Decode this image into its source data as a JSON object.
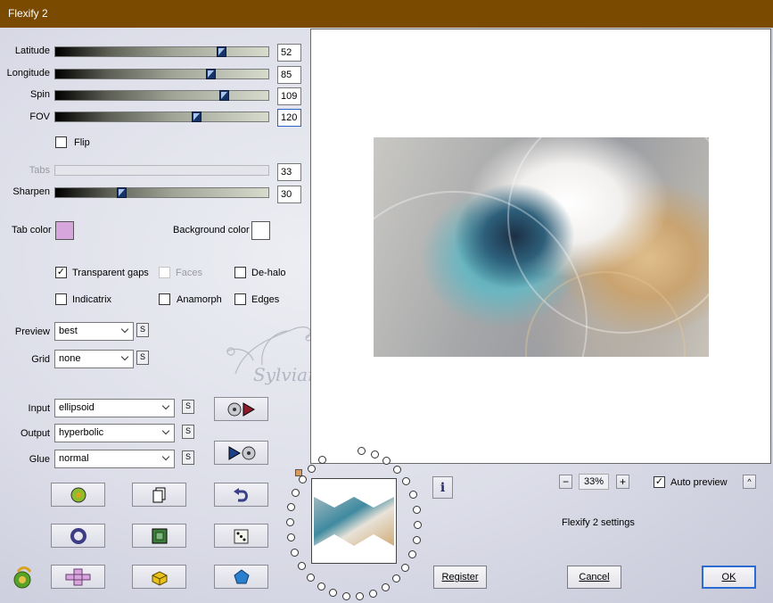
{
  "window": {
    "title": "Flexify 2"
  },
  "sliders": [
    {
      "label": "Latitude",
      "value": "52",
      "level": 0.78
    },
    {
      "label": "Longitude",
      "value": "85",
      "level": 0.73
    },
    {
      "label": "Spin",
      "value": "109",
      "level": 0.79
    },
    {
      "label": "FOV",
      "value": "120",
      "level": 0.66
    }
  ],
  "flip": {
    "label": "Flip",
    "checked": false
  },
  "tabs": {
    "label": "Tabs",
    "value": "33",
    "enabled": false
  },
  "sharpen": {
    "label": "Sharpen",
    "value": "30",
    "level": 0.31
  },
  "colors": {
    "tab_label": "Tab color",
    "tab_color": "#d7a6dc",
    "background_label": "Background color",
    "background_color": "#ffffff",
    "title_bar": "#7a4a00",
    "focus_blue": "#2b64c7",
    "thumb_blue": "#16336a"
  },
  "options": {
    "transparent_gaps": {
      "label": "Transparent gaps",
      "checked": true
    },
    "faces": {
      "label": "Faces",
      "checked": false,
      "enabled": false
    },
    "de_halo": {
      "label": "De-halo",
      "checked": false
    },
    "indicatrix": {
      "label": "Indicatrix",
      "checked": false
    },
    "anamorph": {
      "label": "Anamorph",
      "checked": false
    },
    "edges": {
      "label": "Edges",
      "checked": false
    }
  },
  "preview_select": {
    "label": "Preview",
    "value": "best"
  },
  "grid_select": {
    "label": "Grid",
    "value": "none"
  },
  "input_select": {
    "label": "Input",
    "value": "ellipsoid"
  },
  "output_select": {
    "label": "Output",
    "value": "hyperbolic"
  },
  "glue_select": {
    "label": "Glue",
    "value": "normal"
  },
  "s_label": "S",
  "zoom": {
    "minus": "−",
    "value": "33%",
    "plus": "+"
  },
  "auto_preview": {
    "label": "Auto preview",
    "checked": true
  },
  "settings_name": "Flexify 2 settings",
  "buttons": {
    "register": "Register",
    "cancel": "Cancel",
    "ok": "OK"
  },
  "info_icon_text": "i",
  "watermark_text": "Sylviane"
}
